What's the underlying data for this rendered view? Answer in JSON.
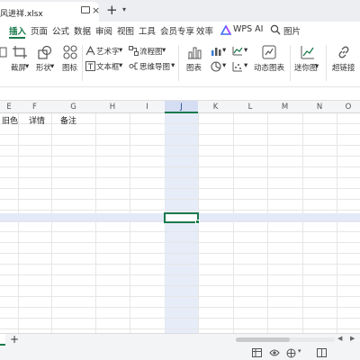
{
  "titlebar": {
    "filename": "风进祥.xlsx",
    "close": "×",
    "new_tab": "+",
    "dropdown": "▾"
  },
  "menu": {
    "items": [
      "插入",
      "页面",
      "公式",
      "数据",
      "审阅",
      "视图",
      "工具",
      "会员专享",
      "效率"
    ],
    "active": "插入",
    "wps_ai": "WPS AI",
    "search": "图片"
  },
  "ribbon": {
    "labels": {
      "screenshot": "截屏",
      "shape": "形状",
      "icon": "图标",
      "art_text": "艺术字",
      "textbox": "文本框",
      "flowchart": "流程图",
      "mindmap": "思维导图",
      "chart": "图表",
      "dynamic_chart": "动态图表",
      "sparkline": "迷你图",
      "hyperlink": "超链接"
    },
    "caret": "▾"
  },
  "sheet": {
    "columns": [
      "E",
      "F",
      "G",
      "H",
      "I",
      "J",
      "K",
      "L",
      "M",
      "N",
      "O"
    ],
    "header_row": [
      "旧色",
      "详情",
      "备注"
    ],
    "selected_column": "J"
  },
  "sheetbar": {
    "add": "+"
  },
  "colors": {
    "accent": "#1a7a4c",
    "highlight": "#e3e9f8",
    "grid": "#e6e6e6"
  }
}
